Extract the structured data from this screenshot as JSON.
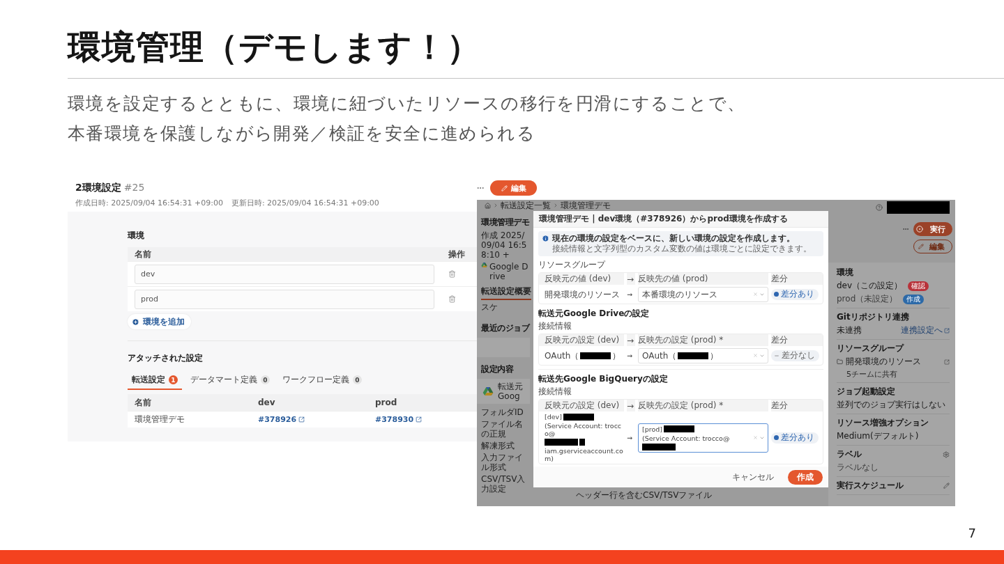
{
  "slide": {
    "title": "環境管理（デモします！）",
    "subtitle": [
      "環境を設定するとともに、環境に紐づいたリソースの移行を円滑にすることで、",
      "本番環境を保護しながら開発／検証を安全に進められる"
    ],
    "page_number": "7"
  },
  "environment_page": {
    "title": "2環境設定",
    "number": "#25",
    "created": "作成日時: 2025/09/04 16:54:31 +09:00",
    "updated": "更新日時: 2025/09/04 16:54:31 +09:00",
    "edit_button": "編集",
    "environments": {
      "title": "環境",
      "columns": [
        "名前",
        "操作"
      ],
      "rows": [
        {
          "value": "dev"
        },
        {
          "value": "prod"
        }
      ],
      "add_button": "環境を追加"
    },
    "attached": {
      "title": "アタッチされた設定",
      "tabs": [
        {
          "label": "転送設定",
          "count": "1",
          "selected": true
        },
        {
          "label": "データマート定義",
          "count": "0",
          "selected": false
        },
        {
          "label": "ワークフロー定義",
          "count": "0",
          "selected": false
        }
      ],
      "columns": [
        "名前",
        "dev",
        "prod"
      ],
      "rows": [
        {
          "name": "環境管理デモ",
          "dev": "#378926",
          "prod": "#378930"
        }
      ]
    }
  },
  "transfer_page": {
    "breadcrumb": [
      "転送設定一覧",
      "環境管理デモ"
    ],
    "title": "環境管理デモ",
    "meta": "作成 2025/09/04 16:58:10 +",
    "source": "Google Drive",
    "tabs": [
      {
        "label": "転送設定概要",
        "selected": true
      },
      {
        "label": "スケ",
        "selected": false
      }
    ],
    "recent_jobs": "最近のジョブ",
    "settings_title": "設定内容",
    "source_card": [
      "転送元",
      "Goog"
    ],
    "settings_rows": [
      "フォルダID",
      "ファイル名の正規",
      "解凍形式",
      "入力ファイル形式",
      "CSV/TSV入力設定"
    ],
    "settings_value": "ヘッダー行を含むCSV/TSVファイル",
    "actions": {
      "run": "実行",
      "edit": "編集"
    },
    "sidebar": [
      {
        "kind": "environments",
        "title": "環境",
        "items": [
          {
            "label": "dev（この設定）",
            "tag": "確認",
            "color": "#b8323a",
            "disabled": false
          },
          {
            "label": "prod（未設定）",
            "tag": "作成",
            "color": "#2d6aa8",
            "disabled": true
          }
        ]
      },
      {
        "kind": "link",
        "title": "Gitリポジトリ連携",
        "value": "未連携",
        "link": "連携設定へ"
      },
      {
        "kind": "resource",
        "title": "リソースグループ",
        "value": "開発環境のリソース",
        "sub": "5チームに共有"
      },
      {
        "kind": "plain",
        "title": "ジョブ起動設定",
        "value": "並列でのジョブ実行はしない"
      },
      {
        "kind": "plain",
        "title": "リソース増強オプション",
        "value": "Medium(デフォルト)"
      },
      {
        "kind": "settings",
        "title": "ラベル",
        "value": "ラベルなし"
      },
      {
        "kind": "editable",
        "title": "実行スケジュール"
      }
    ]
  },
  "modal": {
    "title": "環境管理デモ | dev環境（#378926）からprod環境を作成する",
    "info": [
      "現在の環境の設定をベースに、新しい環境の設定を作成します。",
      "接続情報と文字列型のカスタム変数の値は環境ごとに設定できます。"
    ],
    "sections": [
      {
        "kind": "label",
        "title": "リソースグループ",
        "columns": [
          "反映元の値 (dev)",
          "→",
          "反映先の値 (prod)",
          "差分"
        ],
        "rows": [
          {
            "source": [
              {
                "kind": "text",
                "text": "開発環境のリソース"
              }
            ],
            "arrow": "→",
            "target": [
              {
                "kind": "text",
                "text": "本番環境のリソース"
              }
            ],
            "focused": false,
            "diff": {
              "kind": "changed",
              "label": "差分あり"
            }
          }
        ]
      },
      {
        "kind": "heading",
        "title": "転送元Google Driveの設定",
        "subtitle": "接続情報",
        "columns": [
          "反映元の設定 (dev)",
          "→",
          "反映先の設定 (prod) *",
          "差分"
        ],
        "rows": [
          {
            "source": [
              {
                "kind": "text",
                "text": "OAuth（"
              },
              {
                "kind": "redacted"
              },
              {
                "kind": "text",
                "text": "）"
              }
            ],
            "arrow": "→",
            "target": [
              {
                "kind": "text",
                "text": "OAuth（"
              },
              {
                "kind": "redacted"
              },
              {
                "kind": "text",
                "text": "）"
              }
            ],
            "focused": false,
            "diff": {
              "kind": "same",
              "label": "差分なし"
            }
          }
        ]
      },
      {
        "kind": "heading",
        "title": "転送先Google BigQueryの設定",
        "subtitle": "接続情報",
        "columns": [
          "反映元の設定 (dev)",
          "→",
          "反映先の設定 (prod) *",
          "差分"
        ],
        "rows": [
          {
            "source": [
              {
                "kind": "text",
                "text": "[dev]"
              },
              {
                "kind": "redacted"
              },
              {
                "kind": "text",
                "text": "(Service Account: trocco@"
              },
              {
                "kind": "redacted"
              },
              {
                "kind": "redacted"
              },
              {
                "kind": "text",
                "text": "iam.gserviceaccount.com)"
              }
            ],
            "arrow": "→",
            "target": [
              {
                "kind": "text",
                "text": "[prod]"
              },
              {
                "kind": "redacted"
              },
              {
                "kind": "text",
                "text": "(Service Account: trocco@"
              },
              {
                "kind": "redacted"
              }
            ],
            "focused": true,
            "diff": {
              "kind": "changed",
              "label": "差分あり"
            }
          }
        ]
      }
    ],
    "cancel": "キャンセル",
    "submit": "作成"
  }
}
